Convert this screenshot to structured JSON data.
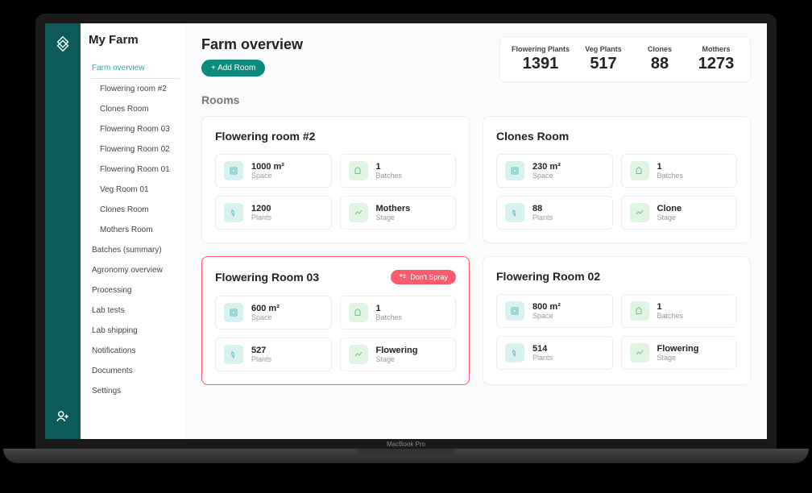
{
  "sidebar": {
    "title": "My Farm",
    "items": [
      {
        "label": "Farm overview",
        "active": true
      },
      {
        "label": "Flowering room #2",
        "sub": true
      },
      {
        "label": "Clones Room",
        "sub": true
      },
      {
        "label": "Flowering Room 03",
        "sub": true
      },
      {
        "label": "Flowering Room 02",
        "sub": true
      },
      {
        "label": "Flowering Room 01",
        "sub": true
      },
      {
        "label": "Veg Room 01",
        "sub": true
      },
      {
        "label": "Clones Room",
        "sub": true
      },
      {
        "label": "Mothers Room",
        "sub": true
      },
      {
        "label": "Batches (summary)"
      },
      {
        "label": "Agronomy overview"
      },
      {
        "label": "Processing"
      },
      {
        "label": "Lab tests"
      },
      {
        "label": "Lab shipping"
      },
      {
        "label": "Notifications"
      },
      {
        "label": "Documents"
      },
      {
        "label": "Settings"
      }
    ]
  },
  "page": {
    "title": "Farm overview",
    "add_button": "+ Add Room",
    "rooms_title": "Rooms"
  },
  "stats": [
    {
      "label": "Flowering Plants",
      "value": "1391"
    },
    {
      "label": "Veg Plants",
      "value": "517"
    },
    {
      "label": "Clones",
      "value": "88"
    },
    {
      "label": "Mothers",
      "value": "1273"
    }
  ],
  "rooms": [
    {
      "name": "Flowering room #2",
      "spray": false,
      "metrics": [
        {
          "icon": "space",
          "value": "1000 m²",
          "label": "Space"
        },
        {
          "icon": "batch",
          "value": "1",
          "label": "Batches"
        },
        {
          "icon": "plant",
          "value": "1200",
          "label": "Plants"
        },
        {
          "icon": "stage",
          "value": "Mothers",
          "label": "Stage"
        }
      ]
    },
    {
      "name": "Clones Room",
      "spray": false,
      "metrics": [
        {
          "icon": "space",
          "value": "230 m²",
          "label": "Space"
        },
        {
          "icon": "batch",
          "value": "1",
          "label": "Batches"
        },
        {
          "icon": "plant",
          "value": "88",
          "label": "Plants"
        },
        {
          "icon": "stage",
          "value": "Clone",
          "label": "Stage"
        }
      ]
    },
    {
      "name": "Flowering Room 03",
      "spray": true,
      "spray_label": "Don't Spray",
      "metrics": [
        {
          "icon": "space",
          "value": "600 m²",
          "label": "Space"
        },
        {
          "icon": "batch",
          "value": "1",
          "label": "Batches"
        },
        {
          "icon": "plant",
          "value": "527",
          "label": "Plants"
        },
        {
          "icon": "stage",
          "value": "Flowering",
          "label": "Stage"
        }
      ]
    },
    {
      "name": "Flowering Room 02",
      "spray": false,
      "metrics": [
        {
          "icon": "space",
          "value": "800 m²",
          "label": "Space"
        },
        {
          "icon": "batch",
          "value": "1",
          "label": "Batches"
        },
        {
          "icon": "plant",
          "value": "514",
          "label": "Plants"
        },
        {
          "icon": "stage",
          "value": "Flowering",
          "label": "Stage"
        }
      ]
    }
  ],
  "laptop_label": "MacBook Pro"
}
